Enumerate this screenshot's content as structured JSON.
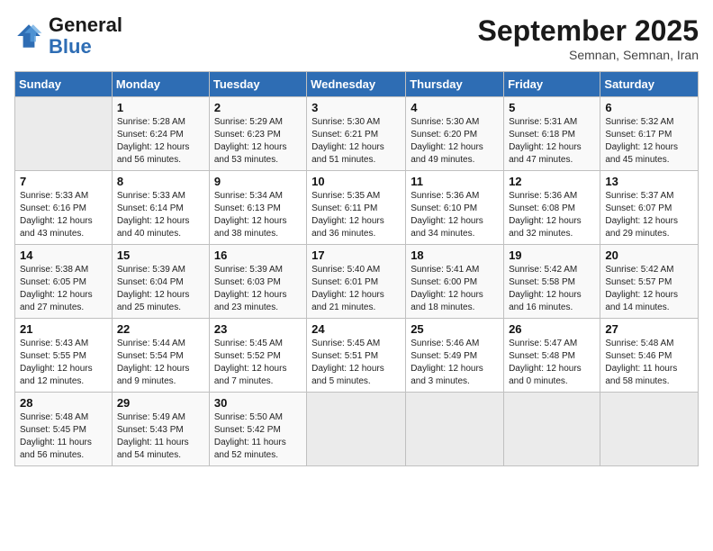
{
  "logo": {
    "line1": "General",
    "line2": "Blue"
  },
  "title": "September 2025",
  "subtitle": "Semnan, Semnan, Iran",
  "weekdays": [
    "Sunday",
    "Monday",
    "Tuesday",
    "Wednesday",
    "Thursday",
    "Friday",
    "Saturday"
  ],
  "weeks": [
    [
      {
        "day": "",
        "info": ""
      },
      {
        "day": "1",
        "info": "Sunrise: 5:28 AM\nSunset: 6:24 PM\nDaylight: 12 hours\nand 56 minutes."
      },
      {
        "day": "2",
        "info": "Sunrise: 5:29 AM\nSunset: 6:23 PM\nDaylight: 12 hours\nand 53 minutes."
      },
      {
        "day": "3",
        "info": "Sunrise: 5:30 AM\nSunset: 6:21 PM\nDaylight: 12 hours\nand 51 minutes."
      },
      {
        "day": "4",
        "info": "Sunrise: 5:30 AM\nSunset: 6:20 PM\nDaylight: 12 hours\nand 49 minutes."
      },
      {
        "day": "5",
        "info": "Sunrise: 5:31 AM\nSunset: 6:18 PM\nDaylight: 12 hours\nand 47 minutes."
      },
      {
        "day": "6",
        "info": "Sunrise: 5:32 AM\nSunset: 6:17 PM\nDaylight: 12 hours\nand 45 minutes."
      }
    ],
    [
      {
        "day": "7",
        "info": "Sunrise: 5:33 AM\nSunset: 6:16 PM\nDaylight: 12 hours\nand 43 minutes."
      },
      {
        "day": "8",
        "info": "Sunrise: 5:33 AM\nSunset: 6:14 PM\nDaylight: 12 hours\nand 40 minutes."
      },
      {
        "day": "9",
        "info": "Sunrise: 5:34 AM\nSunset: 6:13 PM\nDaylight: 12 hours\nand 38 minutes."
      },
      {
        "day": "10",
        "info": "Sunrise: 5:35 AM\nSunset: 6:11 PM\nDaylight: 12 hours\nand 36 minutes."
      },
      {
        "day": "11",
        "info": "Sunrise: 5:36 AM\nSunset: 6:10 PM\nDaylight: 12 hours\nand 34 minutes."
      },
      {
        "day": "12",
        "info": "Sunrise: 5:36 AM\nSunset: 6:08 PM\nDaylight: 12 hours\nand 32 minutes."
      },
      {
        "day": "13",
        "info": "Sunrise: 5:37 AM\nSunset: 6:07 PM\nDaylight: 12 hours\nand 29 minutes."
      }
    ],
    [
      {
        "day": "14",
        "info": "Sunrise: 5:38 AM\nSunset: 6:05 PM\nDaylight: 12 hours\nand 27 minutes."
      },
      {
        "day": "15",
        "info": "Sunrise: 5:39 AM\nSunset: 6:04 PM\nDaylight: 12 hours\nand 25 minutes."
      },
      {
        "day": "16",
        "info": "Sunrise: 5:39 AM\nSunset: 6:03 PM\nDaylight: 12 hours\nand 23 minutes."
      },
      {
        "day": "17",
        "info": "Sunrise: 5:40 AM\nSunset: 6:01 PM\nDaylight: 12 hours\nand 21 minutes."
      },
      {
        "day": "18",
        "info": "Sunrise: 5:41 AM\nSunset: 6:00 PM\nDaylight: 12 hours\nand 18 minutes."
      },
      {
        "day": "19",
        "info": "Sunrise: 5:42 AM\nSunset: 5:58 PM\nDaylight: 12 hours\nand 16 minutes."
      },
      {
        "day": "20",
        "info": "Sunrise: 5:42 AM\nSunset: 5:57 PM\nDaylight: 12 hours\nand 14 minutes."
      }
    ],
    [
      {
        "day": "21",
        "info": "Sunrise: 5:43 AM\nSunset: 5:55 PM\nDaylight: 12 hours\nand 12 minutes."
      },
      {
        "day": "22",
        "info": "Sunrise: 5:44 AM\nSunset: 5:54 PM\nDaylight: 12 hours\nand 9 minutes."
      },
      {
        "day": "23",
        "info": "Sunrise: 5:45 AM\nSunset: 5:52 PM\nDaylight: 12 hours\nand 7 minutes."
      },
      {
        "day": "24",
        "info": "Sunrise: 5:45 AM\nSunset: 5:51 PM\nDaylight: 12 hours\nand 5 minutes."
      },
      {
        "day": "25",
        "info": "Sunrise: 5:46 AM\nSunset: 5:49 PM\nDaylight: 12 hours\nand 3 minutes."
      },
      {
        "day": "26",
        "info": "Sunrise: 5:47 AM\nSunset: 5:48 PM\nDaylight: 12 hours\nand 0 minutes."
      },
      {
        "day": "27",
        "info": "Sunrise: 5:48 AM\nSunset: 5:46 PM\nDaylight: 11 hours\nand 58 minutes."
      }
    ],
    [
      {
        "day": "28",
        "info": "Sunrise: 5:48 AM\nSunset: 5:45 PM\nDaylight: 11 hours\nand 56 minutes."
      },
      {
        "day": "29",
        "info": "Sunrise: 5:49 AM\nSunset: 5:43 PM\nDaylight: 11 hours\nand 54 minutes."
      },
      {
        "day": "30",
        "info": "Sunrise: 5:50 AM\nSunset: 5:42 PM\nDaylight: 11 hours\nand 52 minutes."
      },
      {
        "day": "",
        "info": ""
      },
      {
        "day": "",
        "info": ""
      },
      {
        "day": "",
        "info": ""
      },
      {
        "day": "",
        "info": ""
      }
    ]
  ]
}
